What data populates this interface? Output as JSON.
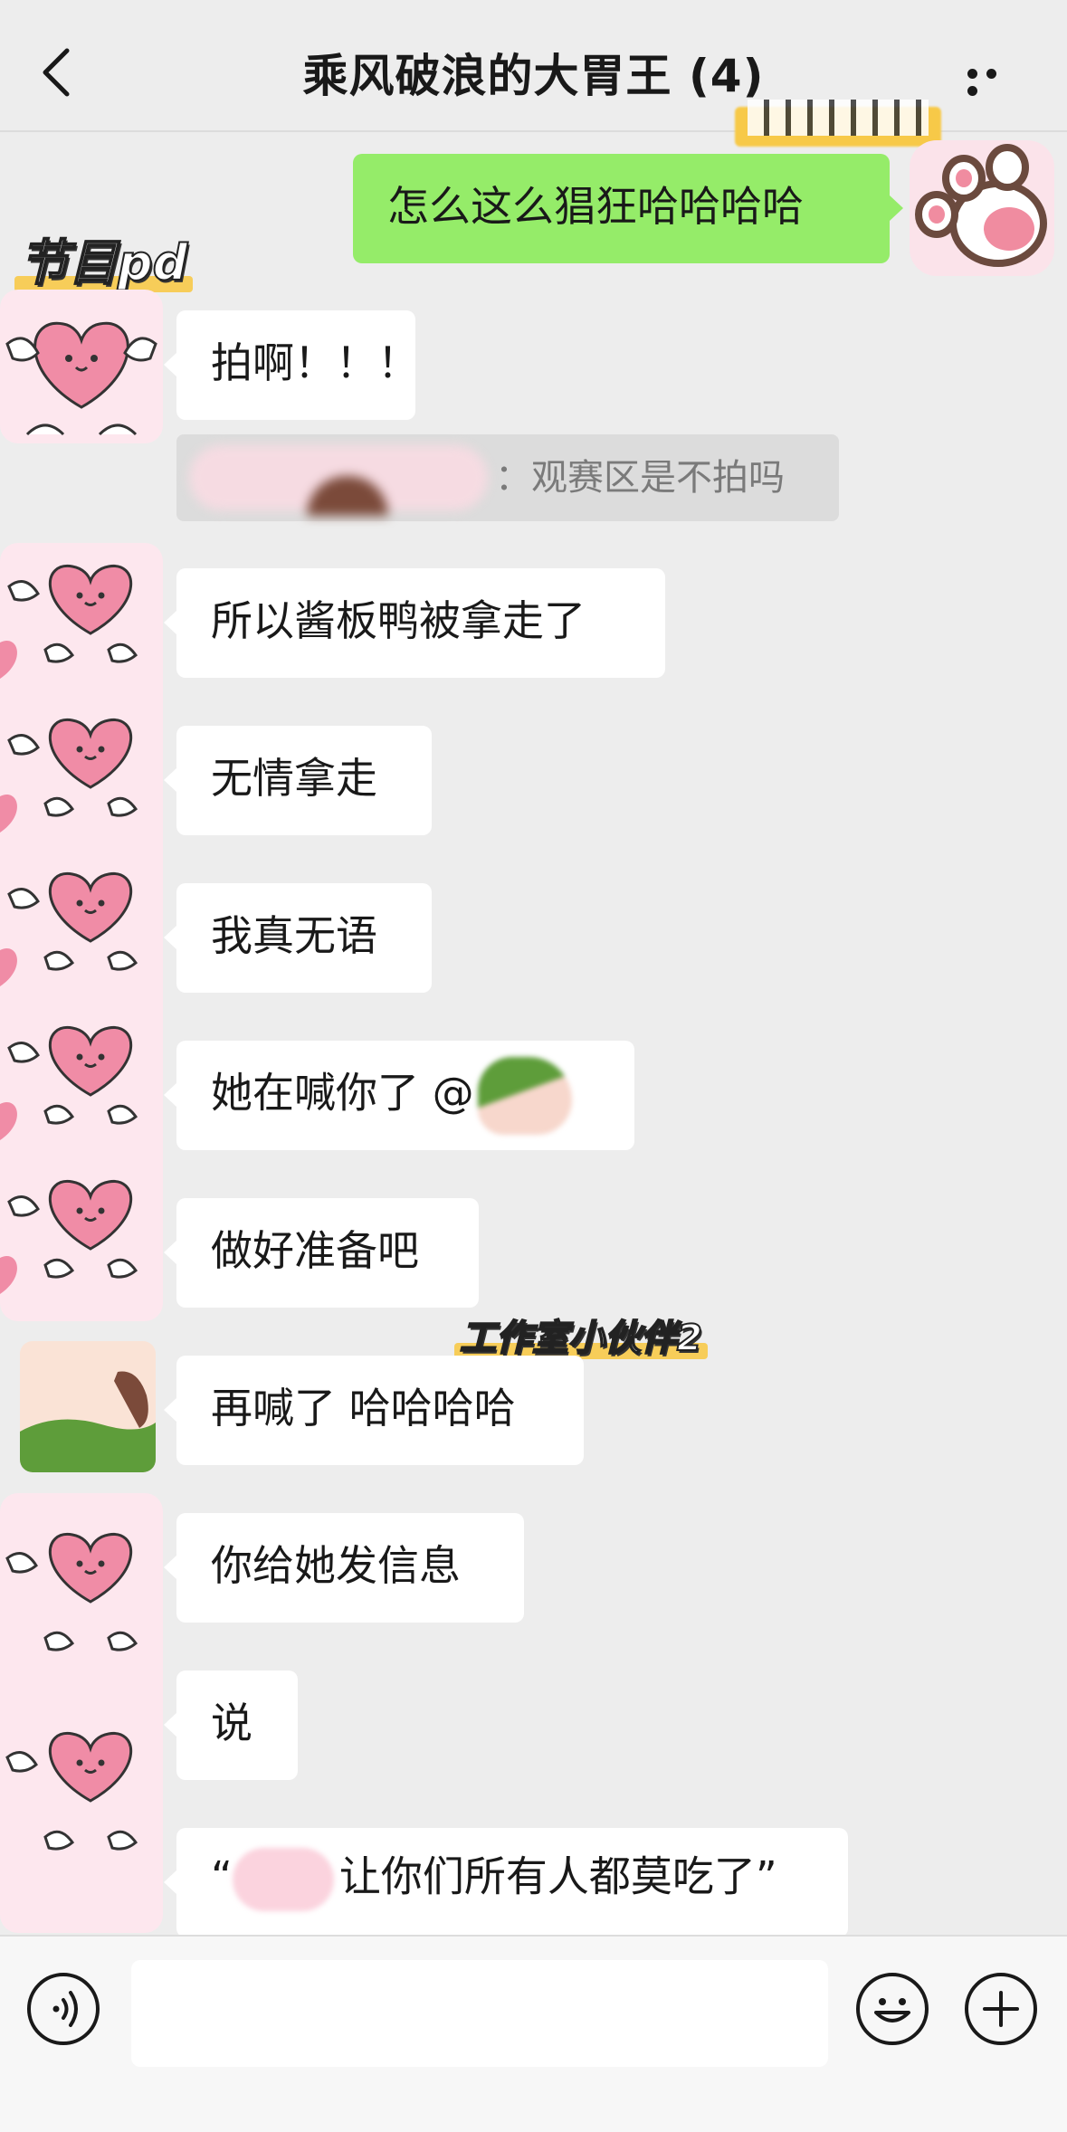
{
  "header": {
    "title": "乘风破浪的大胃王 (4)"
  },
  "stickers": {
    "pd": "节目pd",
    "partner": "工作室小伙伴2"
  },
  "messages": {
    "outgoing_1": "怎么这么猖狂哈哈哈哈",
    "m1": "拍啊！！！",
    "quote_text": "：观赛区是不拍吗",
    "m2": "所以酱板鸭被拿走了",
    "m3": "无情拿走",
    "m4": "我真无语",
    "m5_prefix": "她在喊你了 @",
    "m6": "做好准备吧",
    "m7": "再喊了 哈哈哈哈",
    "m8": "你给她发信息",
    "m9": "说",
    "m10_open": "“",
    "m10_text": "让你们所有人都莫吃了”"
  },
  "icons": [
    "back-icon",
    "more-icon",
    "voice-icon",
    "emoji-icon",
    "plus-icon"
  ],
  "colors": {
    "outgoing_bubble": "#95ec69",
    "incoming_bubble": "#ffffff",
    "background": "#ededed"
  }
}
